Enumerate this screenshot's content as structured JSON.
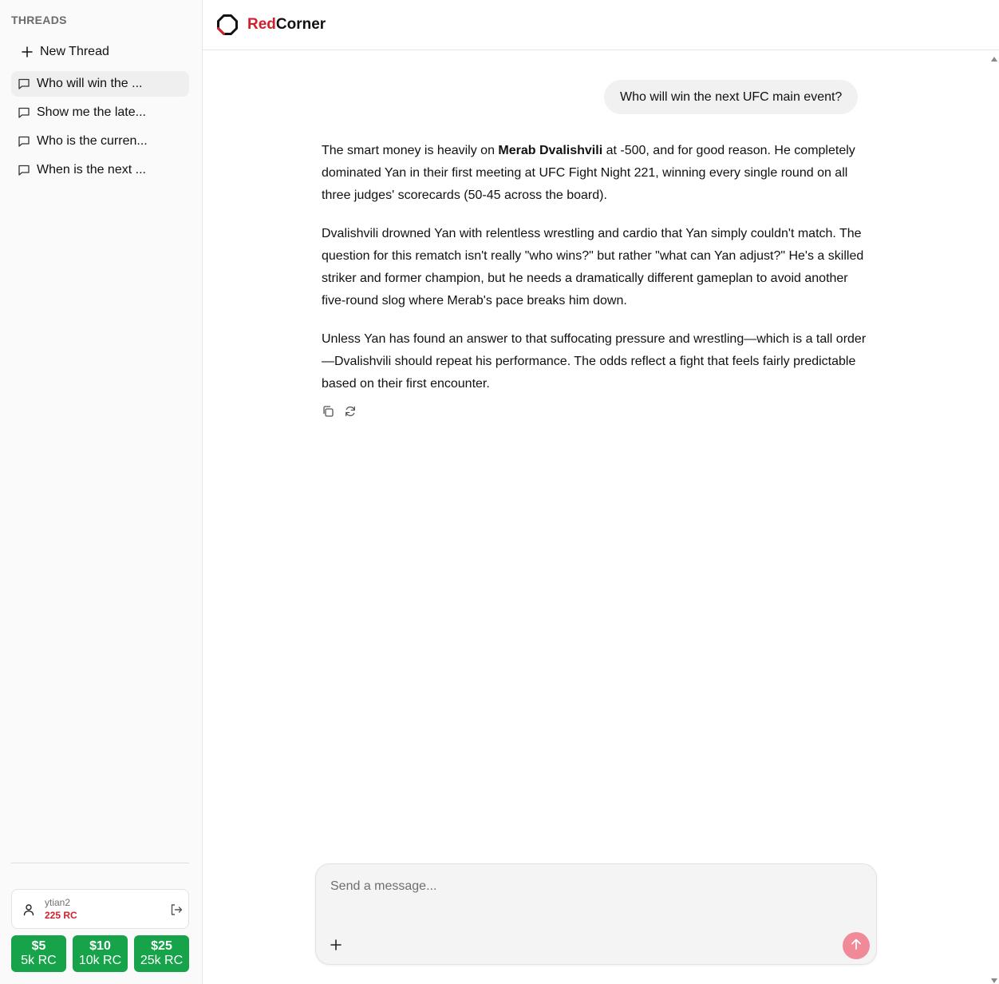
{
  "sidebar": {
    "heading": "THREADS",
    "new_thread_label": "New Thread",
    "threads": [
      {
        "label": "Who will win the ...",
        "active": true
      },
      {
        "label": "Show me the late...",
        "active": false
      },
      {
        "label": "Who is the curren...",
        "active": false
      },
      {
        "label": "When is the next ...",
        "active": false
      }
    ],
    "user": {
      "name": "ytian2",
      "balance": "225 RC"
    },
    "buy_options": [
      {
        "price": "$5",
        "amount": "5k RC"
      },
      {
        "price": "$10",
        "amount": "10k RC"
      },
      {
        "price": "$25",
        "amount": "25k RC"
      }
    ]
  },
  "header": {
    "brand_red": "Red",
    "brand_dark": "Corner"
  },
  "chat": {
    "user_message": "Who will win the next UFC main event?",
    "assistant": {
      "p1_before": "The smart money is heavily on ",
      "p1_bold": "Merab Dvalishvili",
      "p1_after": " at -500, and for good reason. He completely dominated Yan in their first meeting at UFC Fight Night 221, winning every single round on all three judges' scorecards (50-45 across the board).",
      "p2": "Dvalishvili drowned Yan with relentless wrestling and cardio that Yan simply couldn't match. The question for this rematch isn't really \"who wins?\" but rather \"what can Yan adjust?\" He's a skilled striker and former champion, but he needs a dramatically different gameplan to avoid another five-round slog where Merab's pace breaks him down.",
      "p3": "Unless Yan has found an answer to that suffocating pressure and wrestling—which is a tall order—Dvalishvili should repeat his performance. The odds reflect a fight that feels fairly predictable based on their first encounter."
    }
  },
  "composer": {
    "placeholder": "Send a message..."
  },
  "colors": {
    "brand_red": "#d0202e",
    "buy_green": "#16a34a",
    "send_pink": "#f08a99"
  }
}
